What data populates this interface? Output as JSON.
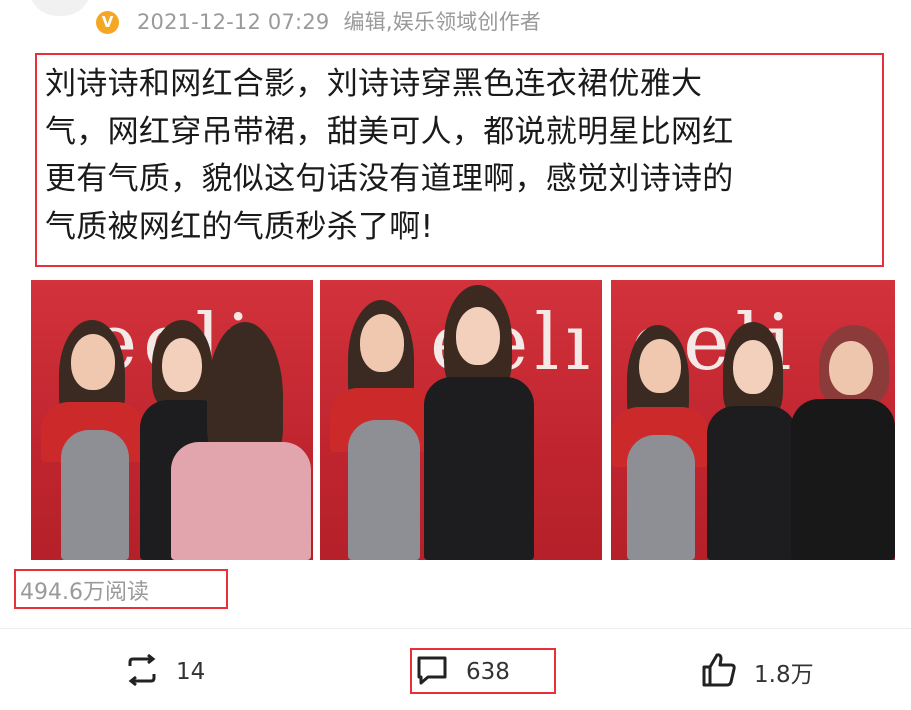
{
  "header": {
    "verified_badge": "V",
    "timestamp": "2021-12-12 07:29",
    "source": "编辑,娱乐领域创作者"
  },
  "post": {
    "lines": [
      "刘诗诗和网红合影，刘诗诗穿黑色连衣裙优雅大",
      "气，网红穿吊带裙，甜美可人，都说就明星比网红",
      "更有气质，貌似这句话没有道理啊，感觉刘诗诗的",
      "气质被网红的气质秒杀了啊!"
    ]
  },
  "photos": [
    {
      "logo_text": "eeli"
    },
    {
      "logo_text": "eelı"
    },
    {
      "logo_text": "eeli"
    }
  ],
  "stats": {
    "reads": "494.6万阅读"
  },
  "actions": {
    "repost_count": "14",
    "comment_count": "638",
    "like_count": "1.8万"
  },
  "colors": {
    "highlight": "#e8303a",
    "verified": "#f5a623",
    "muted_text": "#9a9a9a"
  }
}
